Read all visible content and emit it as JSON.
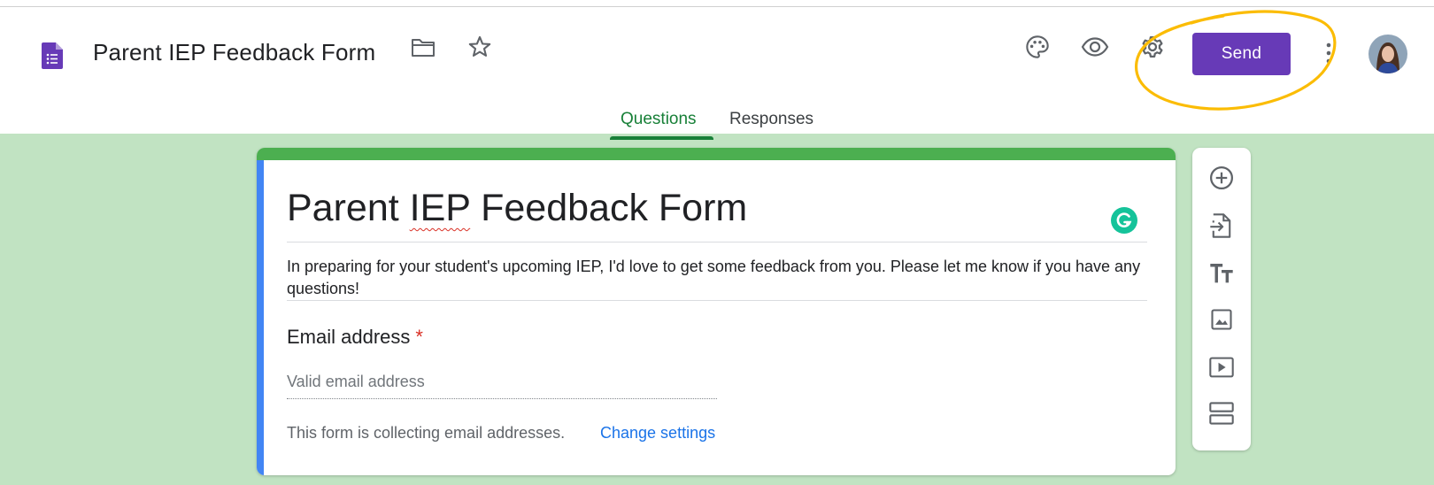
{
  "header": {
    "form_title": "Parent IEP Feedback Form",
    "icons": [
      "forms-doc-icon",
      "folder-icon",
      "star-icon",
      "palette-icon",
      "preview-eye-icon",
      "settings-gear-icon",
      "more-vert-icon"
    ],
    "send_label": "Send",
    "tabs": [
      {
        "label": "Questions",
        "active": true
      },
      {
        "label": "Responses",
        "active": false
      }
    ]
  },
  "form": {
    "title_before": "Parent ",
    "title_iep": "IEP",
    "title_after": " Feedback Form",
    "description": "In preparing for your student's upcoming IEP, I'd love to get some feedback from you. Please let me know if you have any questions!",
    "email_question": {
      "label": "Email address",
      "required_marker": "*",
      "placeholder": "Valid email address"
    },
    "collecting_note": "This form is collecting email addresses.",
    "change_settings_label": "Change settings"
  },
  "toolbar": {
    "items": [
      "add-question-icon",
      "import-questions-icon",
      "add-title-icon",
      "add-image-icon",
      "add-video-icon",
      "add-section-icon"
    ]
  },
  "colors": {
    "theme_background": "#c1e3c2",
    "theme_accent": "#4caf50",
    "send_button": "#673ab7",
    "active_tab": "#188038",
    "link": "#1a73e8",
    "required": "#d93025",
    "annotation": "#fbbc04"
  }
}
